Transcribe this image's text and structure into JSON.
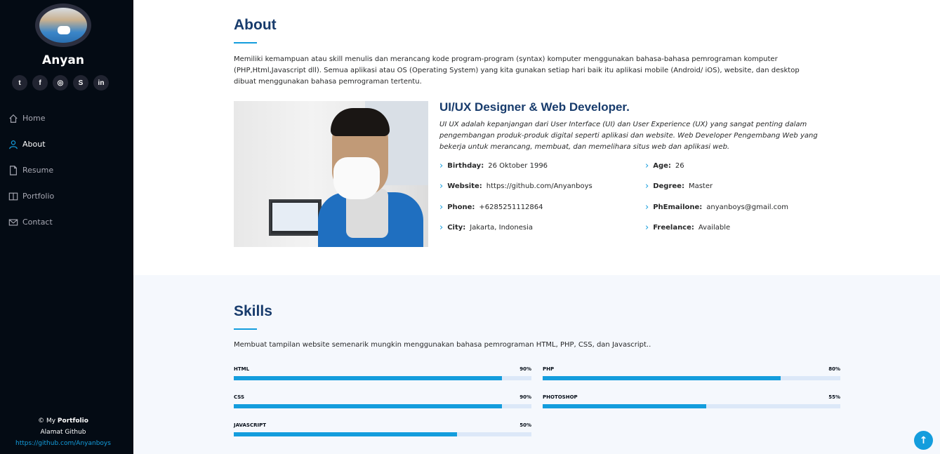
{
  "sidebar": {
    "name": "Anyan",
    "social": [
      {
        "icon": "twitter-icon",
        "glyph": "t"
      },
      {
        "icon": "facebook-icon",
        "glyph": "f"
      },
      {
        "icon": "instagram-icon",
        "glyph": "◎"
      },
      {
        "icon": "skype-icon",
        "glyph": "S"
      },
      {
        "icon": "linkedin-icon",
        "glyph": "in"
      }
    ],
    "nav": [
      {
        "label": "Home",
        "icon": "home-icon",
        "active": false
      },
      {
        "label": "About",
        "icon": "person-icon",
        "active": true
      },
      {
        "label": "Resume",
        "icon": "file-icon",
        "active": false
      },
      {
        "label": "Portfolio",
        "icon": "book-icon",
        "active": false
      },
      {
        "label": "Contact",
        "icon": "envelope-icon",
        "active": false
      }
    ],
    "footer": {
      "copyright_prefix": "© My ",
      "copyright_bold": "Portfolio",
      "github_label": "Alamat Github",
      "github_link": "https://github.com/Anyanboys"
    }
  },
  "about": {
    "title": "About",
    "description": "Memiliki kemampuan atau skill menulis dan merancang kode program-program (syntax) komputer menggunakan bahasa-bahasa pemrograman komputer (PHP,Html,Javascript dll). Semua aplikasi atau OS (Operating System) yang kita gunakan setiap hari baik itu aplikasi mobile (Android/ iOS), website, dan desktop dibuat menggunakan bahasa pemrograman tertentu.",
    "role_title": "UI/UX Designer & Web Developer.",
    "role_description": "UI UX adalah kepanjangan dari User Interface (UI) dan User Experience (UX) yang sangat penting dalam pengembangan produk-produk digital seperti aplikasi dan website. Web Developer Pengembang Web yang bekerja untuk merancang, membuat, dan memelihara situs web dan aplikasi web.",
    "info_left": [
      {
        "label": "Birthday:",
        "value": "26 Oktober 1996"
      },
      {
        "label": "Website:",
        "value": "https://github.com/Anyanboys"
      },
      {
        "label": "Phone:",
        "value": "+6285251112864"
      },
      {
        "label": "City:",
        "value": "Jakarta, Indonesia"
      }
    ],
    "info_right": [
      {
        "label": "Age:",
        "value": "26"
      },
      {
        "label": "Degree:",
        "value": "Master"
      },
      {
        "label": "PhEmailone:",
        "value": "anyanboys@gmail.com"
      },
      {
        "label": "Freelance:",
        "value": "Available"
      }
    ]
  },
  "skills": {
    "title": "Skills",
    "description": "Membuat tampilan website semenarik mungkin menggunakan bahasa pemrograman HTML, PHP, CSS, dan Javascript..",
    "items": [
      {
        "name": "HTML",
        "percent_label": "90%",
        "fill": 0.9
      },
      {
        "name": "PHP",
        "percent_label": "80%",
        "fill": 0.8
      },
      {
        "name": "CSS",
        "percent_label": "90%",
        "fill": 0.9
      },
      {
        "name": "PHOTOSHOP",
        "percent_label": "55%",
        "fill": 0.55
      },
      {
        "name": "JAVASCRIPT",
        "percent_label": "50%",
        "fill": 0.75
      }
    ]
  },
  "colors": {
    "accent": "#149ddd",
    "title": "#173b6c",
    "sidebar_bg": "#040b14"
  },
  "back_to_top": {
    "icon": "arrow-up-icon",
    "glyph": "↑"
  }
}
